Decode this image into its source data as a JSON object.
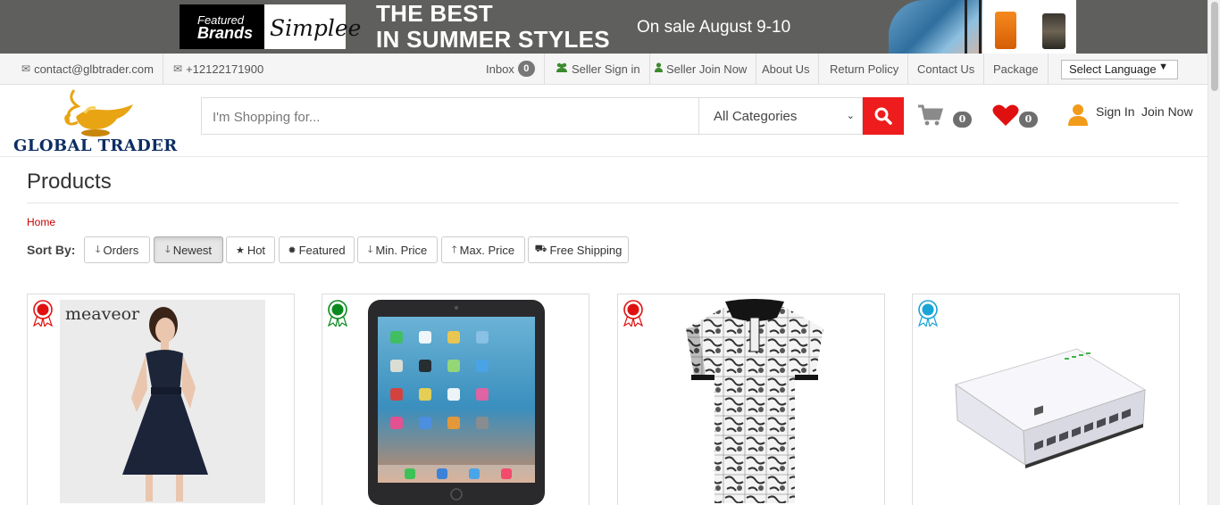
{
  "banner": {
    "brand_small": "Featured",
    "brand_big": "Brands",
    "brand_name": "Simplee",
    "headline_1": "THE BEST",
    "headline_2": "IN SUMMER STYLES",
    "sale_text": "On sale August 9-10"
  },
  "topbar": {
    "email": "contact@glbtrader.com",
    "phone": "+12122171900",
    "inbox_label": "Inbox",
    "inbox_count": "0",
    "seller_sign_in": "Seller Sign in",
    "seller_join": "Seller Join Now",
    "about": "About Us",
    "return_policy": "Return Policy",
    "contact": "Contact Us",
    "package": "Package",
    "language": "Select Language"
  },
  "header": {
    "logo_text": "GLOBAL TRADER",
    "search_placeholder": "I'm Shopping for...",
    "category": "All Categories",
    "cart_count": "0",
    "wishlist_count": "0",
    "sign_in": "Sign In",
    "join_now": "Join Now"
  },
  "page": {
    "title": "Products",
    "breadcrumb_home": "Home",
    "sort_label": "Sort By:"
  },
  "sort_options": [
    {
      "label": "Orders",
      "icon": "arrow-down-icon"
    },
    {
      "label": "Newest",
      "icon": "arrow-down-icon",
      "active": true
    },
    {
      "label": "Hot",
      "icon": "star-icon"
    },
    {
      "label": "Featured",
      "icon": "certificate-icon"
    },
    {
      "label": "Min. Price",
      "icon": "arrow-down-icon"
    },
    {
      "label": "Max. Price",
      "icon": "arrow-up-icon"
    },
    {
      "label": "Free Shipping",
      "icon": "truck-icon"
    }
  ],
  "products": [
    {
      "ribbon_color": "#e01010",
      "image": "navy-dress",
      "brand_mark": "meaveor"
    },
    {
      "ribbon_color": "#0a8a1e",
      "image": "ipad-tablet"
    },
    {
      "ribbon_color": "#e01010",
      "image": "printed-polo-shirt"
    },
    {
      "ribbon_color": "#1aa4d6",
      "image": "network-switch"
    }
  ],
  "colors": {
    "accent_red": "#ee1c1c",
    "logo_navy": "#0d2d63",
    "lamp_gold": "#e8a412",
    "user_orange": "#f29b1a"
  }
}
